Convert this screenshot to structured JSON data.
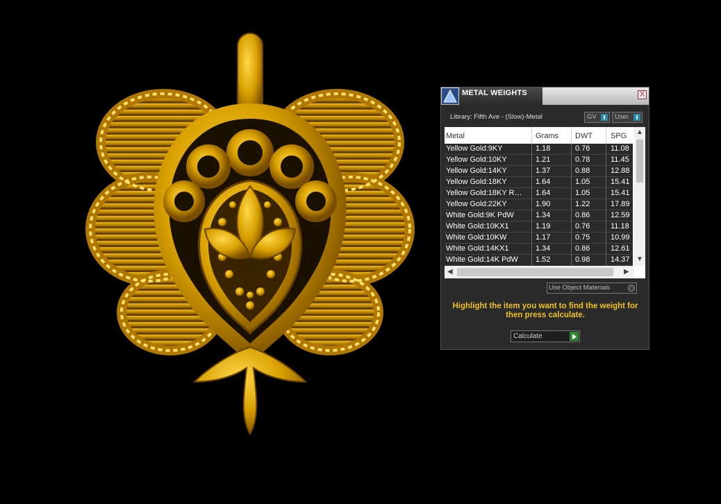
{
  "panel": {
    "title": "METAL WEIGHTS",
    "close_label": "X",
    "library_label": "Library: Fifth Ave - (Slow)-Metal",
    "toggles": [
      "GV",
      "User"
    ],
    "use_object_materials_label": "Use Object Materials",
    "instructions": "Highlight the item you want to find the weight for then press calculate.",
    "calculate_label": "Calculate"
  },
  "table": {
    "headers": [
      "Metal",
      "Grams",
      "DWT",
      "SPG"
    ],
    "rows": [
      [
        "Yellow Gold:9KY",
        "1.18",
        "0.76",
        "11.08"
      ],
      [
        "Yellow Gold:10KY",
        "1.21",
        "0.78",
        "11.45"
      ],
      [
        "Yellow Gold:14KY",
        "1.37",
        "0.88",
        "12.88"
      ],
      [
        "Yellow Gold:18KY",
        "1.64",
        "1.05",
        "15.41"
      ],
      [
        "Yellow Gold:18KY R…",
        "1.64",
        "1.05",
        "15.41"
      ],
      [
        "Yellow Gold:22KY",
        "1.90",
        "1.22",
        "17.89"
      ],
      [
        "White Gold:9K PdW",
        "1.34",
        "0.86",
        "12.59"
      ],
      [
        "White Gold:10KX1",
        "1.19",
        "0.76",
        "11.18"
      ],
      [
        "White Gold:10KW",
        "1.17",
        "0.75",
        "10.99"
      ],
      [
        "White Gold:14KX1",
        "1.34",
        "0.86",
        "12.61"
      ],
      [
        "White Gold:14K PdW",
        "1.52",
        "0.98",
        "14.37"
      ]
    ]
  },
  "colors": {
    "gold": "#e0a800",
    "gold_dark": "#8a5a00",
    "accent_text": "#f0c020"
  }
}
